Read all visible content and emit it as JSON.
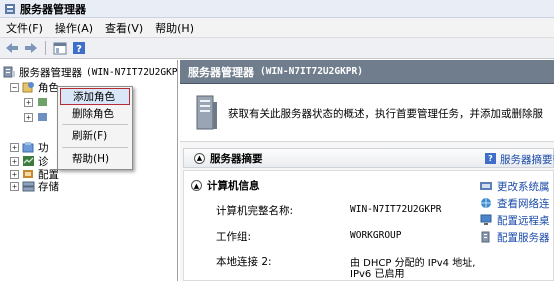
{
  "window": {
    "title": "服务器管理器"
  },
  "menu": [
    "文件(F)",
    "操作(A)",
    "查看(V)",
    "帮助(H)"
  ],
  "toolbar": {
    "back_icon": "back-arrow-icon",
    "forward_icon": "forward-arrow-icon",
    "console_icon": "console-tree-icon",
    "help_icon": "help-icon"
  },
  "tree": {
    "root_label": "服务器管理器",
    "root_host": "(WIN-N7IT72U2GKP",
    "roles_label": "角色",
    "features_label": "功",
    "diagnostics_label": "诊",
    "config_label": "配置",
    "storage_label": "存储"
  },
  "context_menu": {
    "items": [
      "添加角色",
      "删除角色",
      "刷新(F)",
      "帮助(H)"
    ]
  },
  "content": {
    "header_title": "服务器管理器",
    "header_host": "(WIN-N7IT72U2GKPR)",
    "banner_text": "获取有关此服务器状态的概述，执行首要管理任务，并添加或删除服",
    "summary_title": "服务器摘要",
    "summary_help": "服务器摘要帮",
    "computer_info_title": "计算机信息",
    "fields": [
      {
        "label": "计算机完整名称:",
        "value": "WIN-N7IT72U2GKPR"
      },
      {
        "label": "工作组:",
        "value": "WORKGROUP"
      },
      {
        "label": "本地连接 2:",
        "value": "由 DHCP 分配的 IPv4 地址,",
        "value2": "IPv6 已启用"
      }
    ],
    "actions": [
      "更改系统属",
      "查看网络连",
      "配置远程桌",
      "配置服务器"
    ]
  },
  "colors": {
    "accent": "#b62c35",
    "header_bg": "#6f7d8c",
    "link": "#1a4aa8",
    "highlight": "#d8e6f7"
  }
}
